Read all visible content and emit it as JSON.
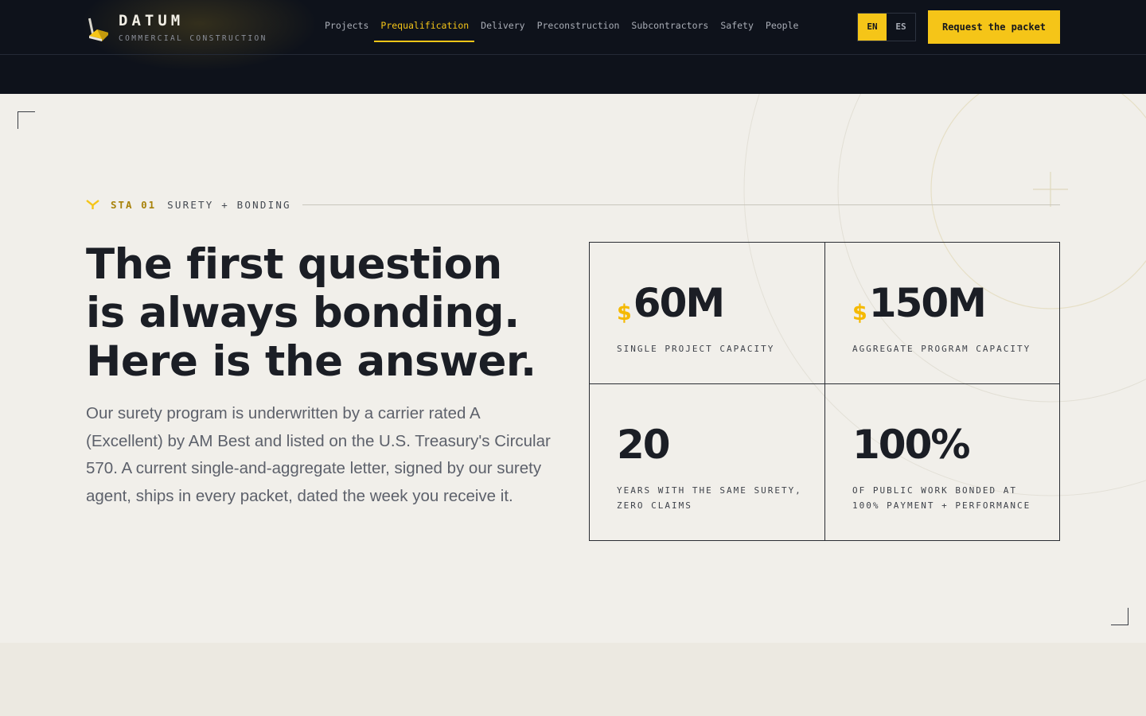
{
  "brand": {
    "name": "DATUM",
    "tagline": "COMMERCIAL CONSTRUCTION"
  },
  "nav": {
    "items": [
      {
        "label": "Projects",
        "active": false
      },
      {
        "label": "Prequalification",
        "active": true
      },
      {
        "label": "Delivery",
        "active": false
      },
      {
        "label": "Preconstruction",
        "active": false
      },
      {
        "label": "Subcontractors",
        "active": false
      },
      {
        "label": "Safety",
        "active": false
      },
      {
        "label": "People",
        "active": false
      }
    ]
  },
  "language": {
    "options": [
      "EN",
      "ES"
    ],
    "selected": "EN"
  },
  "cta": {
    "label": "Request the packet"
  },
  "section": {
    "code": "STA 01",
    "label": "SURETY + BONDING",
    "headline": [
      "The first question",
      "is always bonding.",
      "Here is the answer."
    ],
    "body": "Our surety program is underwritten by a carrier rated A (Excellent) by AM Best and listed on the U.S. Treasury's Circular 570. A current single-and-aggregate letter, signed by our surety agent, ships in every packet, dated the week you receive it."
  },
  "stats": [
    {
      "currency": "$",
      "value": "60M",
      "label": "SINGLE PROJECT CAPACITY"
    },
    {
      "currency": "$",
      "value": "150M",
      "label": "AGGREGATE PROGRAM CAPACITY"
    },
    {
      "currency": "",
      "value": "20",
      "label": "YEARS WITH THE SAME SURETY, ZERO CLAIMS"
    },
    {
      "currency": "",
      "value": "100%",
      "label": "OF PUBLIC WORK BONDED AT 100% PAYMENT + PERFORMANCE"
    }
  ],
  "colors": {
    "accent": "#f5c518",
    "dark": "#0e121b",
    "paper": "#f1efea",
    "ink": "#1b1e25"
  },
  "icons": {
    "brand": "hardhat-logo-icon",
    "eyebrow": "chevron-marker-icon"
  }
}
